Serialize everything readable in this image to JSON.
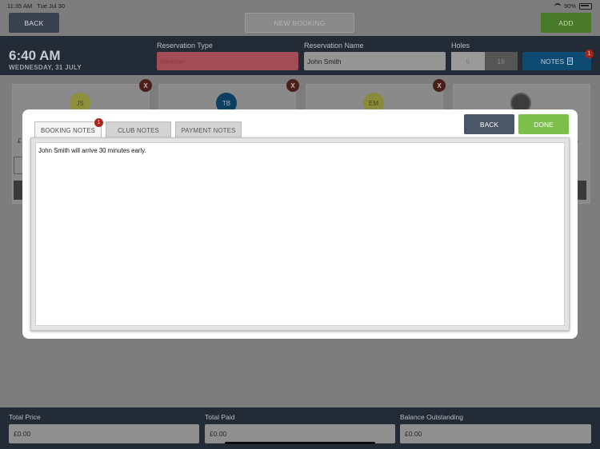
{
  "status_bar": {
    "time": "11:35 AM",
    "date": "Tue Jul 30",
    "battery": "90%"
  },
  "toolbar": {
    "back_label": "BACK",
    "new_booking_label": "NEW BOOKING",
    "add_label": "ADD"
  },
  "header": {
    "time": "6:40 AM",
    "date": "WEDNESDAY, 31 JULY",
    "reservation_type_label": "Reservation Type",
    "reservation_type_value": "Member",
    "reservation_name_label": "Reservation Name",
    "reservation_name_value": "John Smith",
    "holes_label": "Holes",
    "holes_options": [
      "9",
      "18"
    ],
    "notes_label": "NOTES",
    "notes_badge": "1"
  },
  "players": [
    {
      "initials": "JS",
      "color": "#b3b34a"
    },
    {
      "initials": "TB",
      "color": "#0d4c73"
    },
    {
      "initials": "EM",
      "color": "#a8a84a"
    }
  ],
  "background_fragments": {
    "currency": "£"
  },
  "remove_label": "X",
  "modal": {
    "tabs": [
      {
        "label": "BOOKING NOTES",
        "badge": "1",
        "active": true
      },
      {
        "label": "CLUB NOTES",
        "active": false
      },
      {
        "label": "PAYMENT NOTES",
        "active": false
      }
    ],
    "back_label": "BACK",
    "done_label": "DONE",
    "note_text": "John Smith will arrive 30 minutes early."
  },
  "footer": {
    "total_price_label": "Total Price",
    "total_price_value": "£0.00",
    "total_paid_label": "Total Paid",
    "total_paid_value": "£0.00",
    "balance_label": "Balance Outstanding",
    "balance_value": "£0.00"
  },
  "colors": {
    "accent_blue": "#0f4a73",
    "done_green": "#7cc04b",
    "badge_red": "#a8271c",
    "header_navy": "#232b37"
  }
}
